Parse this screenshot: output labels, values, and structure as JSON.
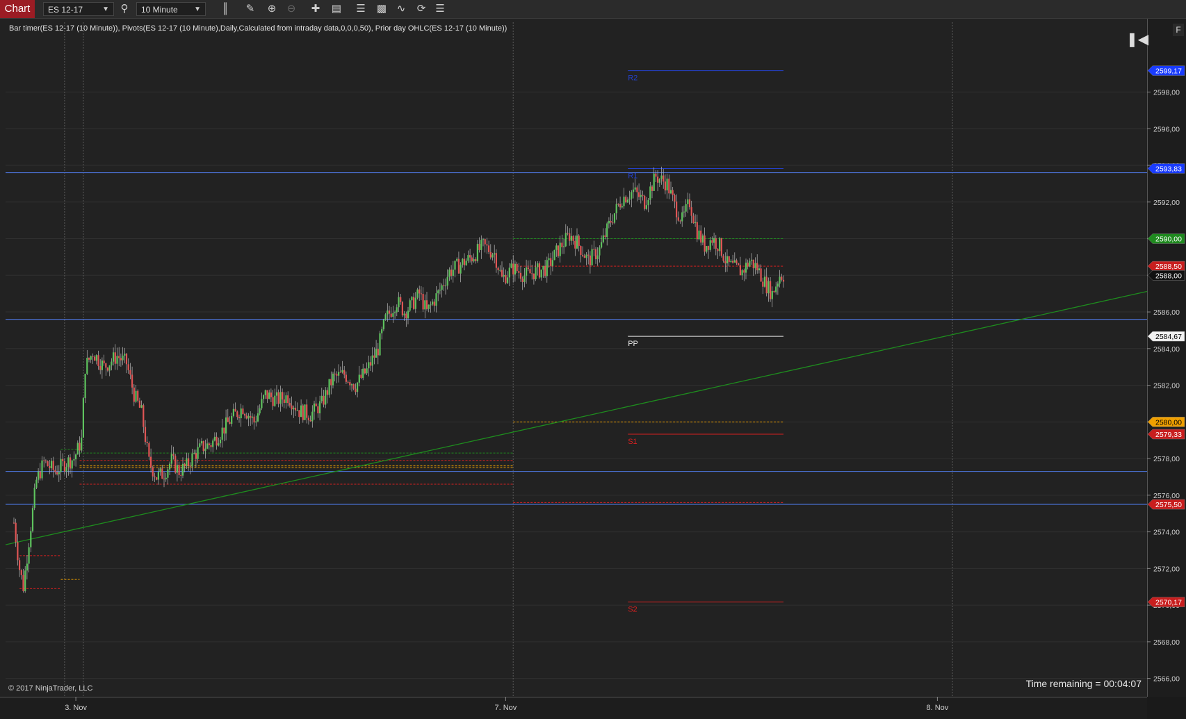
{
  "toolbar": {
    "title": "Chart",
    "instrument": "ES 12-17",
    "interval": "10 Minute",
    "icons": [
      "bars-type-icon",
      "pencil-icon",
      "zoom-in-icon",
      "zoom-out-icon",
      "crosshair-icon",
      "data-box-icon",
      "properties-icon",
      "strategies-icon",
      "indicators-icon",
      "reload-icon",
      "templates-icon"
    ]
  },
  "indicator_label": "Bar timer(ES 12-17 (10 Minute)), Pivots(ES 12-17 (10 Minute),Daily,Calculated from intraday data,0,0,0,50), Prior day OHLC(ES 12-17 (10 Minute))",
  "copyright": "© 2017 NinjaTrader, LLC",
  "timer_text": "Time remaining = 00:04:07",
  "f_button": "F",
  "chart_data": {
    "type": "candlestick",
    "instrument": "ES 12-17",
    "interval": "10 Minute",
    "y_range": [
      2565,
      2602
    ],
    "y_ticks": [
      "2566,00",
      "2568,00",
      "2570,00",
      "2572,00",
      "2574,00",
      "2576,00",
      "2578,00",
      "2580,00",
      "2582,00",
      "2584,00",
      "2586,00",
      "2588,00",
      "2590,00",
      "2592,00",
      "2594,00",
      "2596,00",
      "2598,00"
    ],
    "y_tick_values": [
      2566,
      2568,
      2570,
      2572,
      2574,
      2576,
      2578,
      2580,
      2582,
      2584,
      2586,
      2588,
      2590,
      2592,
      2594,
      2596,
      2598
    ],
    "x_labels": [
      {
        "label": "3. Nov",
        "bar": 33
      },
      {
        "label": "7. Nov",
        "bar": 262
      },
      {
        "label": "8. Nov",
        "bar": 492
      }
    ],
    "price_markers": [
      {
        "value": 2599.17,
        "text": "2599,17",
        "color": "#1a3cff",
        "fg": "#ffffff"
      },
      {
        "value": 2593.83,
        "text": "2593,83",
        "color": "#1a3cff",
        "fg": "#ffffff"
      },
      {
        "value": 2590.0,
        "text": "2590,00",
        "color": "#1f8a1f",
        "fg": "#ffffff"
      },
      {
        "value": 2588.5,
        "text": "2588,50",
        "color": "#c81e1e",
        "fg": "#ffffff"
      },
      {
        "value": 2588.0,
        "text": "2588,00",
        "color": "#111111",
        "fg": "#ffffff"
      },
      {
        "value": 2584.67,
        "text": "2584,67",
        "color": "#f2f2f2",
        "fg": "#000000"
      },
      {
        "value": 2580.0,
        "text": "2580,00",
        "color": "#f0a000",
        "fg": "#000000"
      },
      {
        "value": 2579.33,
        "text": "2579,33",
        "color": "#c81e1e",
        "fg": "#ffffff"
      },
      {
        "value": 2575.5,
        "text": "2575,50",
        "color": "#c81e1e",
        "fg": "#ffffff"
      },
      {
        "value": 2570.17,
        "text": "2570,17",
        "color": "#c81e1e",
        "fg": "#ffffff"
      }
    ],
    "horizontal_lines": [
      {
        "value": 2593.6,
        "color": "#4a6fd0"
      },
      {
        "value": 2585.6,
        "color": "#4a6fd0"
      },
      {
        "value": 2577.3,
        "color": "#4a6fd0"
      },
      {
        "value": 2575.5,
        "color": "#4a6fd0"
      }
    ],
    "pivot_labels": [
      {
        "label": "R2",
        "value": 2599.17,
        "color": "#2440c8"
      },
      {
        "label": "R1",
        "value": 2593.83,
        "color": "#2440c8"
      },
      {
        "label": "PP",
        "value": 2584.67,
        "color": "#e8e8e8"
      },
      {
        "label": "S1",
        "value": 2579.33,
        "color": "#d62020"
      },
      {
        "label": "S2",
        "value": 2570.17,
        "color": "#d62020"
      }
    ],
    "pivot_segment": {
      "from_bar": 326,
      "to_bar": 410
    },
    "prior_day_segments": [
      {
        "value": 2572.7,
        "from_bar": 3,
        "to_bar": 25,
        "color": "#d62020"
      },
      {
        "value": 2571.4,
        "from_bar": 25,
        "to_bar": 35,
        "color": "#f0a000"
      },
      {
        "value": 2570.9,
        "from_bar": 3,
        "to_bar": 25,
        "color": "#d62020"
      },
      {
        "value": 2578.5,
        "from_bar": 25,
        "to_bar": 35,
        "color": "#1f8a1f"
      },
      {
        "value": 2578.3,
        "from_bar": 35,
        "to_bar": 266,
        "color": "#1f8a1f"
      },
      {
        "value": 2577.9,
        "from_bar": 35,
        "to_bar": 266,
        "color": "#d62020"
      },
      {
        "value": 2577.6,
        "from_bar": 35,
        "to_bar": 266,
        "color": "#f0a000"
      },
      {
        "value": 2577.5,
        "from_bar": 35,
        "to_bar": 266,
        "color": "#f0a000"
      },
      {
        "value": 2576.6,
        "from_bar": 35,
        "to_bar": 266,
        "color": "#d62020"
      },
      {
        "value": 2580.0,
        "from_bar": 266,
        "to_bar": 410,
        "color": "#f0a000"
      },
      {
        "value": 2588.5,
        "from_bar": 266,
        "to_bar": 410,
        "color": "#d62020"
      },
      {
        "value": 2590.0,
        "from_bar": 266,
        "to_bar": 410,
        "color": "#1f8a1f"
      },
      {
        "value": 2575.6,
        "from_bar": 266,
        "to_bar": 410,
        "color": "#d62020"
      }
    ],
    "trend_line": {
      "from": {
        "bar": 0,
        "value": 2573.4
      },
      "to": {
        "bar": 550,
        "value": 2585.9
      },
      "color": "#1e8c1e"
    },
    "session_breaks": [
      27,
      37,
      266,
      500
    ],
    "candle_colors": {
      "up": "#5ec35e",
      "down": "#e05555",
      "wick": "#bbbbbb"
    },
    "close_path": [
      [
        0,
        2574.5
      ],
      [
        3,
        2572.0
      ],
      [
        5,
        2571.0
      ],
      [
        8,
        2573.5
      ],
      [
        12,
        2576.8
      ],
      [
        16,
        2577.8
      ],
      [
        22,
        2577.3
      ],
      [
        28,
        2577.8
      ],
      [
        32,
        2578.0
      ],
      [
        36,
        2579.0
      ],
      [
        38,
        2583.0
      ],
      [
        42,
        2583.8
      ],
      [
        48,
        2583.0
      ],
      [
        55,
        2583.6
      ],
      [
        60,
        2583.2
      ],
      [
        64,
        2581.5
      ],
      [
        68,
        2580.5
      ],
      [
        72,
        2577.8
      ],
      [
        76,
        2577.0
      ],
      [
        80,
        2577.2
      ],
      [
        84,
        2577.9
      ],
      [
        88,
        2577.3
      ],
      [
        92,
        2577.6
      ],
      [
        96,
        2578.2
      ],
      [
        100,
        2578.6
      ],
      [
        105,
        2578.8
      ],
      [
        110,
        2579.4
      ],
      [
        116,
        2580.2
      ],
      [
        122,
        2580.8
      ],
      [
        128,
        2580.0
      ],
      [
        134,
        2581.5
      ],
      [
        140,
        2581.2
      ],
      [
        146,
        2581.4
      ],
      [
        152,
        2580.6
      ],
      [
        158,
        2580.4
      ],
      [
        164,
        2581.0
      ],
      [
        170,
        2582.4
      ],
      [
        176,
        2582.6
      ],
      [
        182,
        2582.0
      ],
      [
        188,
        2582.8
      ],
      [
        194,
        2584.0
      ],
      [
        198,
        2585.6
      ],
      [
        204,
        2586.6
      ],
      [
        208,
        2586.0
      ],
      [
        212,
        2586.4
      ],
      [
        216,
        2587.0
      ],
      [
        220,
        2586.0
      ],
      [
        226,
        2587.0
      ],
      [
        232,
        2588.2
      ],
      [
        238,
        2588.6
      ],
      [
        244,
        2589.0
      ],
      [
        250,
        2589.6
      ],
      [
        256,
        2589.2
      ],
      [
        260,
        2587.8
      ],
      [
        266,
        2588.4
      ],
      [
        272,
        2588.0
      ],
      [
        278,
        2588.2
      ],
      [
        284,
        2588.4
      ],
      [
        290,
        2589.4
      ],
      [
        296,
        2590.2
      ],
      [
        300,
        2589.8
      ],
      [
        306,
        2588.8
      ],
      [
        312,
        2589.4
      ],
      [
        318,
        2591.0
      ],
      [
        324,
        2592.2
      ],
      [
        330,
        2592.6
      ],
      [
        336,
        2592.0
      ],
      [
        342,
        2593.4
      ],
      [
        348,
        2593.0
      ],
      [
        352,
        2591.8
      ],
      [
        356,
        2591.0
      ],
      [
        360,
        2592.0
      ],
      [
        364,
        2590.4
      ],
      [
        368,
        2589.6
      ],
      [
        372,
        2590.0
      ],
      [
        376,
        2589.6
      ],
      [
        380,
        2588.6
      ],
      [
        384,
        2588.4
      ],
      [
        388,
        2588.2
      ],
      [
        392,
        2588.8
      ],
      [
        396,
        2588.4
      ],
      [
        400,
        2587.6
      ],
      [
        404,
        2587.0
      ],
      [
        408,
        2588.0
      ],
      [
        410,
        2588.0
      ]
    ]
  }
}
